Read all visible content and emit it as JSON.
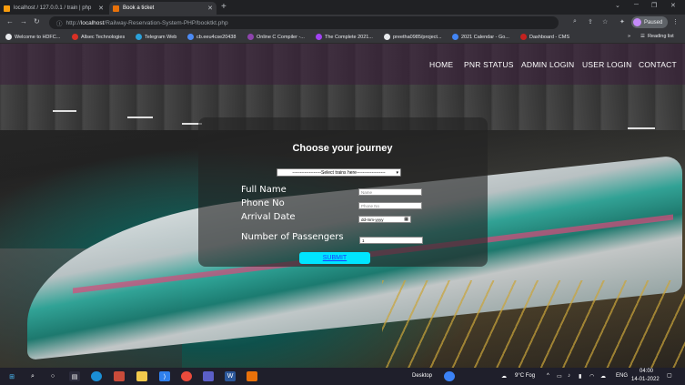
{
  "browser": {
    "tabs": [
      {
        "title": "localhost / 127.0.0.1 / train | php"
      },
      {
        "title": "Book a ticket"
      }
    ],
    "new_tab": "+",
    "url_host": "localhost",
    "url_prefix": "http://",
    "url_path": "/Railway-Reservation-System-PHP/booktkt.php",
    "profile_name": "Paused",
    "reading_list": "Reading list",
    "bookmarks": [
      "Welcome to HDFC...",
      "Allsec Technologies",
      "Telegram Web",
      "cb.eeu4cse20438",
      "Online C Compiler -...",
      "The Complete 2021...",
      "preetha0985/project...",
      "2021 Calendar - Go...",
      "Dashboard - CMS"
    ]
  },
  "site": {
    "nav": [
      "HOME",
      "PNR STATUS",
      "ADMIN LOGIN",
      "USER LOGIN",
      "CONTACT"
    ],
    "form": {
      "title": "Choose your journey",
      "train_select": "-------------------Select trains here-------------------",
      "fields": {
        "full_name": {
          "label": "Full Name",
          "placeholder": "Name"
        },
        "phone": {
          "label": "Phone No",
          "placeholder": "Phone No"
        },
        "arrival": {
          "label": "Arrival Date",
          "value": "dd-mm-yyyy"
        },
        "passengers": {
          "label": "Number of Passengers",
          "value": "1"
        }
      },
      "submit": "SUBMIT"
    }
  },
  "taskbar": {
    "desktop": "Desktop",
    "weather": "9°C Fog",
    "language": "ENG",
    "time": "04:00",
    "date": "14-01-2022"
  },
  "colors": {
    "submit_bg": "#00e5ff",
    "header_overlay": "#3a1e3a",
    "accent_teal": "#2ab3a5"
  }
}
